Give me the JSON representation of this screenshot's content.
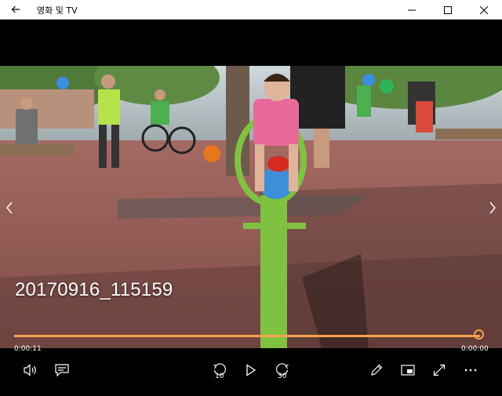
{
  "window": {
    "title": "영화 및 TV",
    "back_icon": "back-arrow-icon",
    "minimize_icon": "minimize-icon",
    "maximize_icon": "maximize-icon",
    "close_icon": "close-icon"
  },
  "video": {
    "title": "20170916_115159",
    "prev_icon": "chevron-left-icon",
    "next_icon": "chevron-right-icon"
  },
  "playback": {
    "elapsed": "0:00:11",
    "remaining": "0:00:00",
    "progress": 1.0,
    "accent_color": "#f5a24b"
  },
  "controls": {
    "volume_icon": "volume-icon",
    "captions_icon": "captions-icon",
    "skip_back_label": "10",
    "play_icon": "play-icon",
    "skip_forward_label": "30",
    "edit_icon": "pencil-icon",
    "mini_view_icon": "mini-view-icon",
    "fullscreen_icon": "fullscreen-icon",
    "more_icon": "more-icon"
  }
}
